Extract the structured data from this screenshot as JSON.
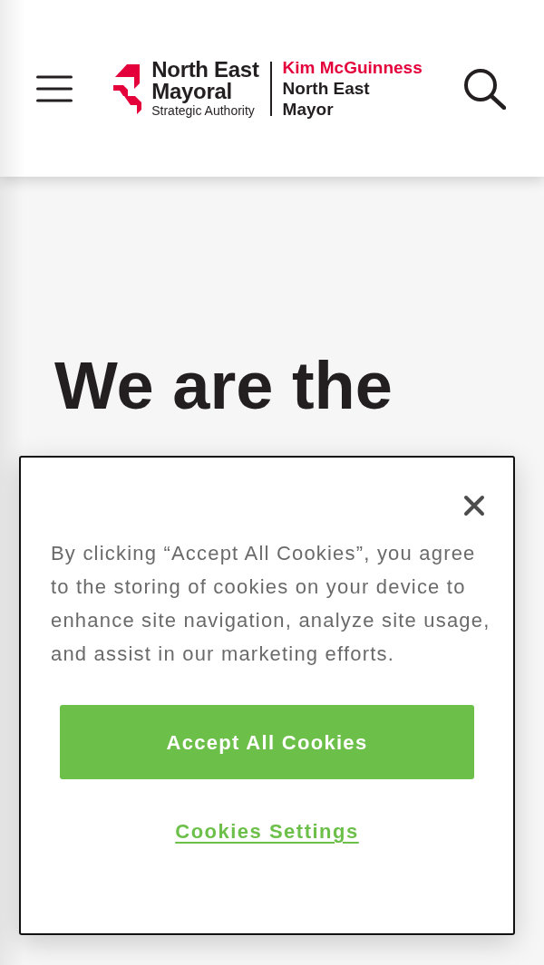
{
  "header": {
    "logo": {
      "organisation_lines": [
        "North East",
        "Mayoral"
      ],
      "organisation_subtitle": "Strategic Authority",
      "person_name": "Kim McGuinness",
      "person_title_lines": [
        "North East",
        "Mayor"
      ]
    }
  },
  "hero": {
    "heading": "We are the"
  },
  "cookie_banner": {
    "message": "By clicking “Accept All Cookies”, you agree to the storing of cookies on your device to enhance site navigation, analyze site usage, and assist in our marketing efforts.",
    "buttons": [
      {
        "kind": "primary",
        "label": "Accept All Cookies"
      },
      {
        "kind": "link",
        "label": "Cookies Settings"
      }
    ]
  }
}
